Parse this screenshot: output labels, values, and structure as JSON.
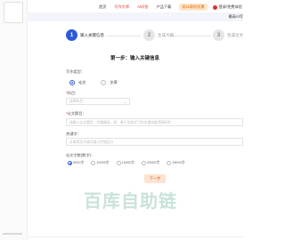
{
  "nav": {
    "items": [
      "首页",
      "写作大师",
      "AI问答",
      "产品下载",
      "双11限时优惠"
    ],
    "user": "登录/免费体验"
  },
  "subbar": {
    "text": "最高AI写"
  },
  "steps": [
    {
      "num": "1",
      "label": "输入关键信息"
    },
    {
      "num": "2",
      "label": "生成大纲"
    },
    {
      "num": "3",
      "label": "生成论文"
    }
  ],
  "form": {
    "title": "第一步：输入关键信息",
    "type_label": "写作类型：",
    "type_options": [
      "论文",
      "文章"
    ],
    "subject_label": "科目：",
    "subject_placeholder": "选择科目",
    "title_label": "论文题目：",
    "title_placeholder": "请输入论文题目，完整精准，如：基于深度学习的交通流量预测研究",
    "keyword_label": "关键字：",
    "keyword_placeholder": "文章提及关键词请以空格区分",
    "count_label": "论文字数(数字)：",
    "count_options": [
      "5000字",
      "10000字",
      "15000字",
      "20000字",
      "25000字"
    ],
    "next_label": "下一步"
  },
  "watermark": "百库自助链",
  "colors": {
    "primary": "#2d5bd7",
    "accent_red": "#d9342b",
    "next_bg": "#fde3d0",
    "watermark": "#c9e3da"
  }
}
